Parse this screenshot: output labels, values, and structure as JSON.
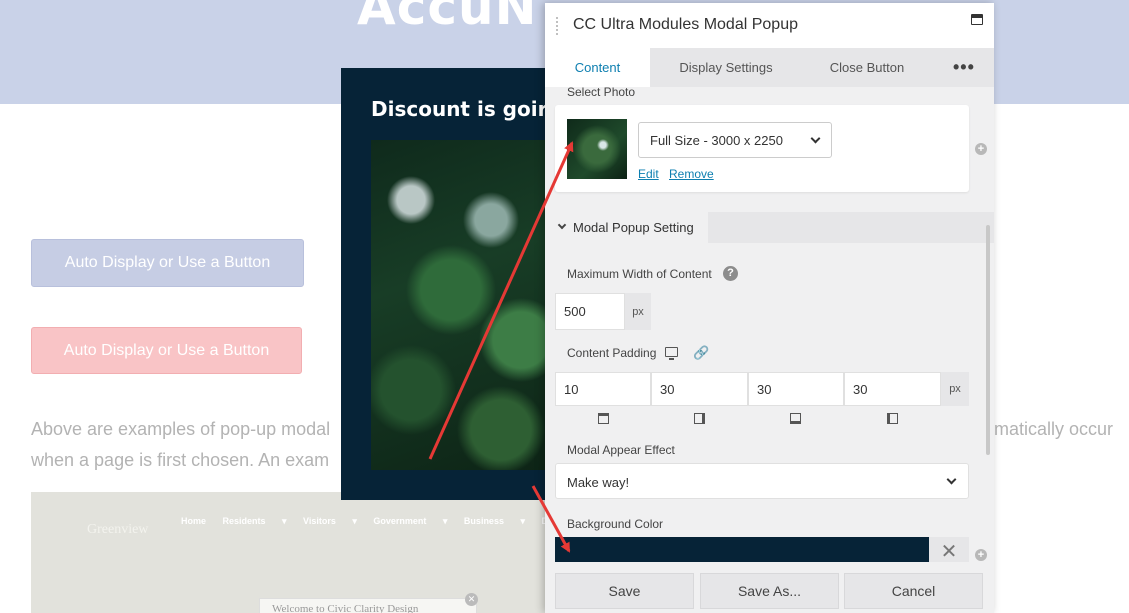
{
  "background_page": {
    "hero_title": "AccuN",
    "button_blue": "Auto Display or Use a Button",
    "button_red": "Auto Display or Use a Button",
    "para_line1": "Above are examples of pop-up modal",
    "para_line2": "when a page is first chosen.  An exam",
    "para_right": "matically occur",
    "site_logo": "Greenview",
    "site_nav": "Home Residents ▾ Visitors ▾ Government ▾ Business ▾ Document Ce",
    "site_welcome": "Welcome to Civic Clarity Design"
  },
  "modal_preview": {
    "heading": "Discount is goir"
  },
  "panel": {
    "title": "CC Ultra Modules Modal Popup",
    "tabs": [
      "Content",
      "Display Settings",
      "Close Button"
    ],
    "more": "•••",
    "select_photo_label": "Select Photo",
    "photo_size": "Full Size - 3000 x 2250",
    "edit_link": "Edit",
    "remove_link": "Remove",
    "section_title": "Modal Popup Setting",
    "max_width_label": "Maximum Width of Content",
    "max_width_value": "500",
    "max_width_unit": "px",
    "padding_label": "Content Padding",
    "padding_values": [
      "10",
      "30",
      "30",
      "30"
    ],
    "padding_unit": "px",
    "effect_label": "Modal Appear Effect",
    "effect_value": "Make way!",
    "bg_color_label": "Background Color",
    "bg_color": "#062337",
    "clear_symbol": "✕",
    "help_symbol": "?",
    "plus_symbol": "+",
    "save": "Save",
    "save_as": "Save As...",
    "cancel": "Cancel"
  },
  "colors": {
    "accent": "#0e7fb0",
    "arrow": "#e53935",
    "modal_bg": "#062337"
  }
}
